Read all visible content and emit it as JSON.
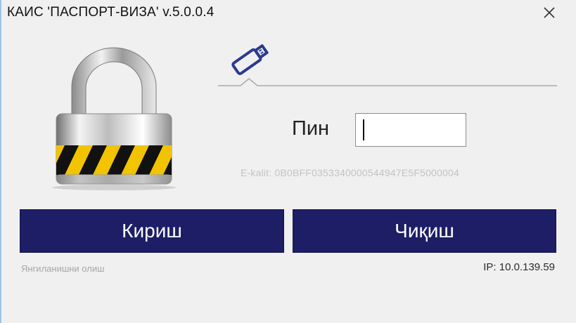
{
  "window": {
    "title": "КАИС 'ПАСПОРТ-ВИЗА' v.5.0.0.4"
  },
  "login": {
    "tab_icon": "usb-stick-icon",
    "pin_label": "Пин",
    "pin_value": "",
    "e_kalit": "E-kalit: 0B0BFF0353340000544947E5F5000004"
  },
  "buttons": {
    "enter_label": "Кириш",
    "exit_label": "Чиқиш"
  },
  "footer": {
    "update_label": "Янгиланишни олиш",
    "ip": "IP: 10.0.139.59"
  },
  "colors": {
    "button_bg": "#1e1e66",
    "button_text": "#ffffff",
    "tab_icon": "#2b3a8f"
  }
}
